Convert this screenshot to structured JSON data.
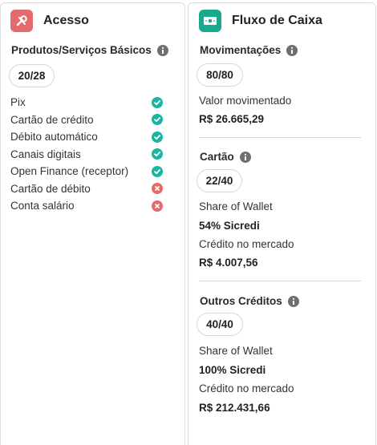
{
  "acesso": {
    "title": "Acesso",
    "icon": "tools-icon",
    "accent": "#e36b6b",
    "section_title": "Produtos/Serviços Básicos",
    "score": "20/28",
    "items": [
      {
        "label": "Pix",
        "status": "ok"
      },
      {
        "label": "Cartão de crédito",
        "status": "ok"
      },
      {
        "label": "Débito automático",
        "status": "ok"
      },
      {
        "label": "Canais digitais",
        "status": "ok"
      },
      {
        "label": "Open Finance (receptor)",
        "status": "ok"
      },
      {
        "label": "Cartão de débito",
        "status": "no"
      },
      {
        "label": "Conta salário",
        "status": "no"
      }
    ]
  },
  "fluxo": {
    "title": "Fluxo de Caixa",
    "icon": "cash-icon",
    "accent": "#1aa88f",
    "movimentacoes": {
      "title": "Movimentações",
      "score": "80/80",
      "label": "Valor movimentado",
      "value": "R$ 26.665,29"
    },
    "cartao": {
      "title": "Cartão",
      "score": "22/40",
      "share_label": "Share of Wallet",
      "share_value": "54% Sicredi",
      "credit_label": "Crédito no mercado",
      "credit_value": "R$ 4.007,56"
    },
    "outros": {
      "title": "Outros Créditos",
      "score": "40/40",
      "share_label": "Share of Wallet",
      "share_value": "100% Sicredi",
      "credit_label": "Crédito no mercado",
      "credit_value": "R$ 212.431,66"
    }
  },
  "colors": {
    "ok": "#1bb5a3",
    "no": "#e46a68",
    "info": "#6f6f6f"
  }
}
